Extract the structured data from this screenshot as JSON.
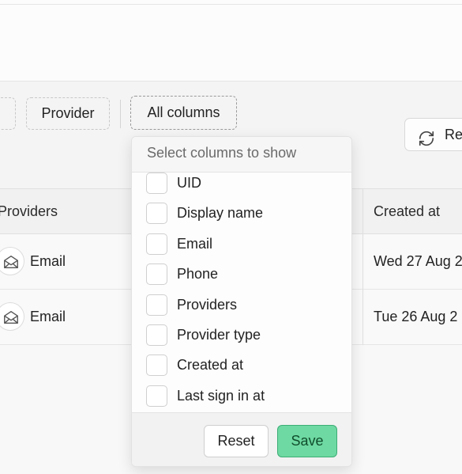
{
  "filters": {
    "provider_label": "Provider",
    "columns_label": "All columns"
  },
  "toolbar": {
    "refresh_label": "Re"
  },
  "table": {
    "headers": {
      "providers": "Providers",
      "created_at": "Created at"
    },
    "rows": [
      {
        "provider": "Email",
        "created_at": "Wed 27 Aug 2"
      },
      {
        "provider": "Email",
        "created_at": "Tue 26 Aug 2"
      }
    ]
  },
  "column_menu": {
    "title": "Select columns to show",
    "options": [
      {
        "label": "UID",
        "checked": false
      },
      {
        "label": "Display name",
        "checked": false
      },
      {
        "label": "Email",
        "checked": false
      },
      {
        "label": "Phone",
        "checked": false
      },
      {
        "label": "Providers",
        "checked": false
      },
      {
        "label": "Provider type",
        "checked": false
      },
      {
        "label": "Created at",
        "checked": false
      },
      {
        "label": "Last sign in at",
        "checked": false
      }
    ],
    "reset_label": "Reset",
    "save_label": "Save"
  },
  "colors": {
    "accent": "#6ed9a2",
    "accent_border": "#3dad76"
  },
  "icons": {
    "refresh": "refresh-icon",
    "mail": "mail-open-icon"
  }
}
